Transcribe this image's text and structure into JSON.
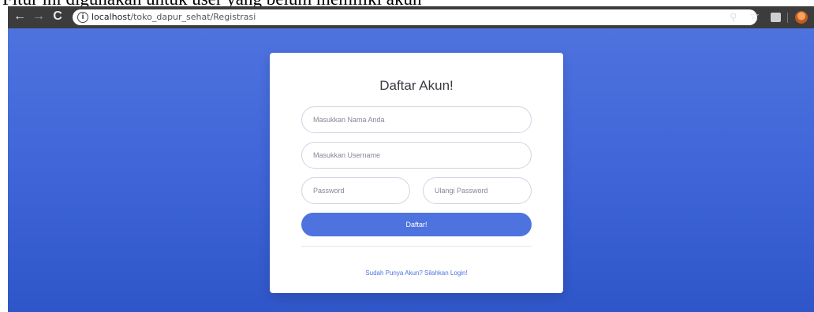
{
  "caption": "Fitur ini digunakan untuk user yang belum memiliki akun",
  "browser": {
    "url_host": "localhost",
    "url_path": "/toko_dapur_sehat/Registrasi"
  },
  "form": {
    "title": "Daftar Akun!",
    "name_placeholder": "Masukkan Nama Anda",
    "username_placeholder": "Masukkan Username",
    "password_placeholder": "Password",
    "repeat_password_placeholder": "Ulangi Password",
    "submit_label": "Daftar!",
    "login_link": "Sudah Punya Akun? Silahkan Login!"
  },
  "colors": {
    "primary": "#4e73df",
    "background_gradient": [
      "#4e73df",
      "#2f56c8"
    ]
  }
}
